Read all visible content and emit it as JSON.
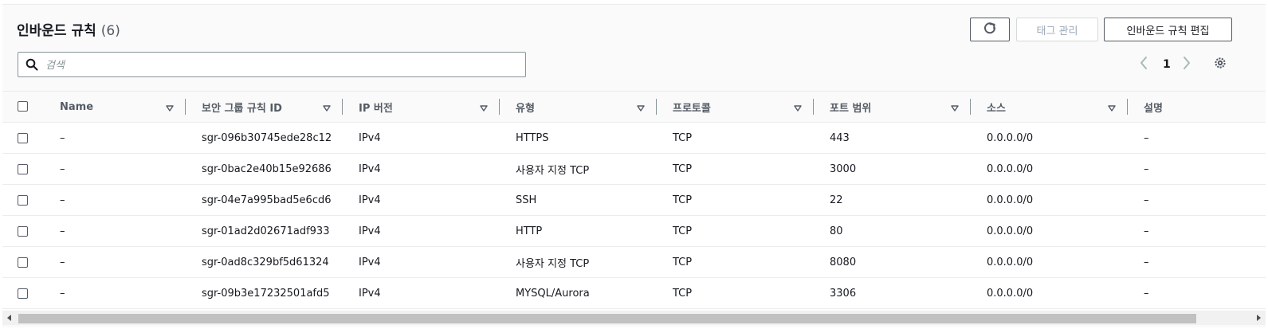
{
  "header": {
    "title": "인바운드 규칙",
    "count": "(6)"
  },
  "buttons": {
    "refresh_icon": "refresh-icon",
    "manage_tags": "태그 관리",
    "edit_inbound_rules": "인바운드 규칙 편집"
  },
  "search": {
    "placeholder": "검색",
    "value": ""
  },
  "pagination": {
    "current_page": "1",
    "prev_icon": "chevron-left-icon",
    "next_icon": "chevron-right-icon",
    "settings_icon": "gear-icon"
  },
  "table": {
    "columns": [
      "Name",
      "보안 그룹 규칙 ID",
      "IP 버전",
      "유형",
      "프로토콜",
      "포트 범위",
      "소스",
      "설명"
    ],
    "rows": [
      {
        "name": "–",
        "rule_id": "sgr-096b30745ede28c12",
        "ip_version": "IPv4",
        "type": "HTTPS",
        "protocol": "TCP",
        "port_range": "443",
        "source": "0.0.0.0/0",
        "description": "–"
      },
      {
        "name": "–",
        "rule_id": "sgr-0bac2e40b15e92686",
        "ip_version": "IPv4",
        "type": "사용자 지정 TCP",
        "protocol": "TCP",
        "port_range": "3000",
        "source": "0.0.0.0/0",
        "description": "–"
      },
      {
        "name": "–",
        "rule_id": "sgr-04e7a995bad5e6cd6",
        "ip_version": "IPv4",
        "type": "SSH",
        "protocol": "TCP",
        "port_range": "22",
        "source": "0.0.0.0/0",
        "description": "–"
      },
      {
        "name": "–",
        "rule_id": "sgr-01ad2d02671adf933",
        "ip_version": "IPv4",
        "type": "HTTP",
        "protocol": "TCP",
        "port_range": "80",
        "source": "0.0.0.0/0",
        "description": "–"
      },
      {
        "name": "–",
        "rule_id": "sgr-0ad8c329bf5d61324",
        "ip_version": "IPv4",
        "type": "사용자 지정 TCP",
        "protocol": "TCP",
        "port_range": "8080",
        "source": "0.0.0.0/0",
        "description": "–"
      },
      {
        "name": "–",
        "rule_id": "sgr-09b3e17232501afd5",
        "ip_version": "IPv4",
        "type": "MYSQL/Aurora",
        "protocol": "TCP",
        "port_range": "3306",
        "source": "0.0.0.0/0",
        "description": "–"
      }
    ]
  },
  "colors": {
    "text_primary": "#16191f",
    "text_secondary": "#545b64",
    "border": "#eaeded",
    "disabled": "#9ba7b6"
  }
}
